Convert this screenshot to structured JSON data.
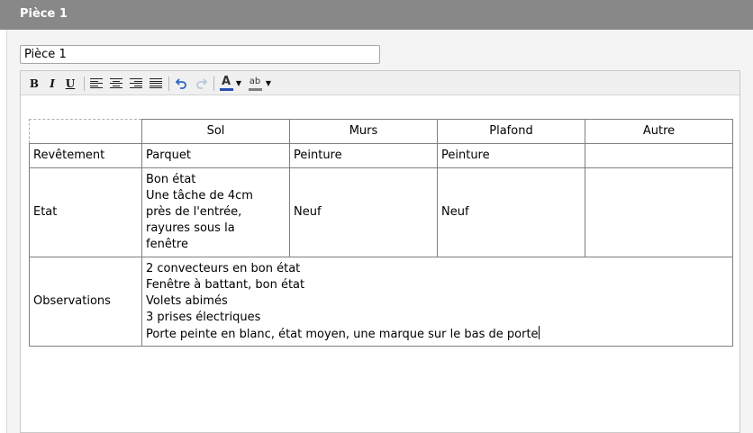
{
  "header": {
    "title": "Pièce 1"
  },
  "title_field": {
    "value": "Pièce 1"
  },
  "toolbar": {
    "bold": "B",
    "italic": "I",
    "underline": "U",
    "font_color_letter": "A",
    "highlight_letters": "ab",
    "font_color_swatch": "#2a4fb5",
    "highlight_swatch": "#808080"
  },
  "table": {
    "headers": [
      "",
      "Sol",
      "Murs",
      "Plafond",
      "Autre"
    ],
    "rows": {
      "revetement": {
        "label": "Revêtement",
        "sol": "Parquet",
        "murs": "Peinture",
        "plafond": "Peinture",
        "autre": ""
      },
      "etat": {
        "label": "Etat",
        "sol_lines": [
          "Bon état",
          "Une tâche de 4cm",
          "près de l'entrée,",
          "rayures sous la",
          "fenêtre"
        ],
        "murs": "Neuf",
        "plafond": "Neuf",
        "autre": ""
      },
      "observations": {
        "label": "Observations",
        "lines": [
          "2 convecteurs en bon état",
          "Fenêtre à battant, bon état",
          "Volets abimés",
          "3 prises électriques",
          "Porte peinte en blanc, état moyen, une marque sur le bas de porte"
        ]
      }
    }
  }
}
